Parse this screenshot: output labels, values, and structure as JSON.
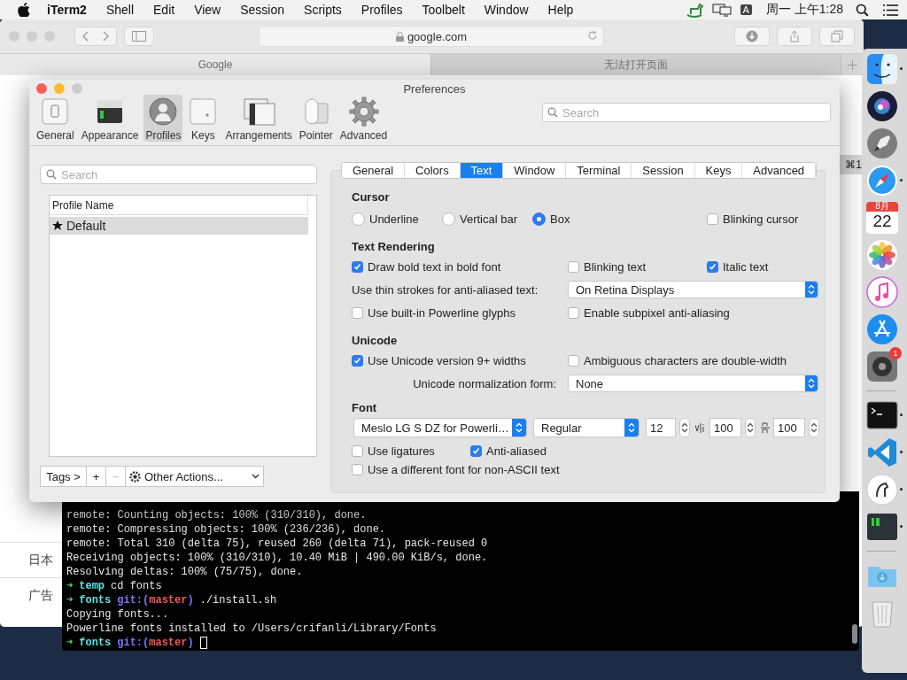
{
  "menu_bar": {
    "app": "iTerm2",
    "menus": [
      "Shell",
      "Edit",
      "View",
      "Session",
      "Scripts",
      "Profiles",
      "Toolbelt",
      "Window",
      "Help"
    ],
    "input_source": "A",
    "clock": "周一 上午1:28"
  },
  "browser": {
    "address": "google.com",
    "tabs": [
      {
        "label": "Google",
        "selected": true
      },
      {
        "label": "无法打开页面",
        "selected": false
      }
    ],
    "shortcut": "⌘1",
    "side_items": [
      "日本",
      "广告"
    ]
  },
  "preferences": {
    "title": "Preferences",
    "search_placeholder": "Search",
    "toolbar": [
      {
        "label": "General",
        "kind": "general",
        "selected": false
      },
      {
        "label": "Appearance",
        "kind": "appearance",
        "selected": false
      },
      {
        "label": "Profiles",
        "kind": "profiles",
        "selected": true
      },
      {
        "label": "Keys",
        "kind": "keys",
        "selected": false
      },
      {
        "label": "Arrangements",
        "kind": "arrangements",
        "selected": false
      },
      {
        "label": "Pointer",
        "kind": "pointer",
        "selected": false
      },
      {
        "label": "Advanced",
        "kind": "advanced",
        "selected": false
      }
    ],
    "profiles": {
      "search_placeholder": "Search",
      "column": "Profile Name",
      "rows": [
        {
          "name": "Default",
          "selected": true,
          "is_default": true
        }
      ],
      "tags_button": "Tags >",
      "add_button": "+",
      "remove_button": {
        "label": "−",
        "disabled": true
      },
      "actions": "Other Actions..."
    },
    "tabs": [
      {
        "label": "General",
        "selected": false
      },
      {
        "label": "Colors",
        "selected": false
      },
      {
        "label": "Text",
        "selected": true
      },
      {
        "label": "Window",
        "selected": false
      },
      {
        "label": "Terminal",
        "selected": false
      },
      {
        "label": "Session",
        "selected": false
      },
      {
        "label": "Keys",
        "selected": false
      },
      {
        "label": "Advanced",
        "selected": false
      }
    ],
    "cursor": {
      "heading": "Cursor",
      "shapes": [
        {
          "label": "Underline",
          "selected": false
        },
        {
          "label": "Vertical bar",
          "selected": false
        },
        {
          "label": "Box",
          "selected": true
        }
      ],
      "blinking": {
        "label": "Blinking cursor",
        "checked": false
      }
    },
    "text_rendering": {
      "heading": "Text Rendering",
      "bold": {
        "label": "Draw bold text in bold font",
        "checked": true
      },
      "blinking_text": {
        "label": "Blinking text",
        "checked": false
      },
      "italic": {
        "label": "Italic text",
        "checked": true
      },
      "thin_strokes": {
        "label": "Use thin strokes for anti-aliased text:",
        "value": "On Retina Displays"
      },
      "powerline": {
        "label": "Use built-in Powerline glyphs",
        "checked": false
      },
      "subpixel": {
        "label": "Enable subpixel anti-aliasing",
        "checked": false
      }
    },
    "unicode": {
      "heading": "Unicode",
      "widths": {
        "label": "Use Unicode version 9+ widths",
        "checked": true
      },
      "ambiguous": {
        "label": "Ambiguous characters are double-width",
        "checked": false
      },
      "normalization": {
        "label": "Unicode normalization form:",
        "value": "None"
      }
    },
    "font": {
      "heading": "Font",
      "family": "Meslo LG S DZ for Powerli…",
      "style": "Regular",
      "size": "12",
      "vertical_spacing": "100",
      "horizontal_spacing": "100",
      "ligatures": {
        "label": "Use ligatures",
        "checked": false
      },
      "anti_aliased": {
        "label": "Anti-aliased",
        "checked": true
      },
      "non_ascii": {
        "label": "Use a different font for non-ASCII text",
        "checked": false
      }
    }
  },
  "terminal": {
    "cursor_visible": true,
    "lines": [
      [
        {
          "kind": "plain",
          "text": "remote: Counting objects: 100% (310/310), done."
        }
      ],
      [
        {
          "kind": "plain",
          "text": "remote: Compressing objects: 100% (236/236), done."
        }
      ],
      [
        {
          "kind": "plain",
          "text": "remote: Total 310 (delta 75), reused 260 (delta 71), pack-reused 0"
        }
      ],
      [
        {
          "kind": "plain",
          "text": "Receiving objects: 100% (310/310), 10.40 MiB | 490.00 KiB/s, done."
        }
      ],
      [
        {
          "kind": "plain",
          "text": "Resolving deltas: 100% (75/75), done."
        }
      ],
      [
        {
          "kind": "arrow",
          "text": "➜"
        },
        {
          "kind": "dir",
          "text": "temp"
        },
        {
          "kind": "plain",
          "text": "cd fonts"
        }
      ],
      [
        {
          "kind": "arrow",
          "text": "➜"
        },
        {
          "kind": "dir",
          "text": "fonts"
        },
        {
          "kind": "git",
          "text": "git:("
        },
        {
          "kind": "branch",
          "text": "master"
        },
        {
          "kind": "git",
          "text": ")"
        },
        {
          "kind": "plain",
          "text": "./install.sh"
        }
      ],
      [
        {
          "kind": "plain",
          "text": "Copying fonts..."
        }
      ],
      [
        {
          "kind": "plain",
          "text": "Powerline fonts installed to /Users/crifanli/Library/Fonts"
        }
      ],
      [
        {
          "kind": "arrow",
          "text": "➜"
        },
        {
          "kind": "dir",
          "text": "fonts"
        },
        {
          "kind": "git",
          "text": "git:("
        },
        {
          "kind": "branch",
          "text": "master"
        },
        {
          "kind": "git",
          "text": ")"
        }
      ]
    ]
  },
  "dock": {
    "items": [
      {
        "kind": "finder",
        "running": true
      },
      {
        "kind": "siri"
      },
      {
        "kind": "launchpad"
      },
      {
        "kind": "safari",
        "running": true
      },
      {
        "kind": "calendar",
        "month": "8月",
        "day": "22"
      },
      {
        "kind": "photos"
      },
      {
        "kind": "music"
      },
      {
        "kind": "appstore"
      },
      {
        "kind": "settings",
        "badge": "1"
      },
      {
        "kind": "separator"
      },
      {
        "kind": "terminal",
        "running": true
      },
      {
        "kind": "vscode",
        "running": true
      },
      {
        "kind": "clock",
        "running": true
      },
      {
        "kind": "shell",
        "running": true
      },
      {
        "kind": "separator"
      },
      {
        "kind": "downloads"
      },
      {
        "kind": "trash"
      }
    ]
  }
}
